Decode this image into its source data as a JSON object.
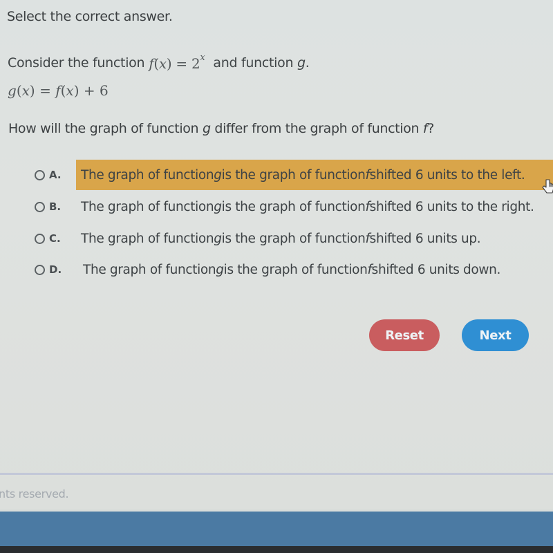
{
  "instruction": "Select the correct answer.",
  "prompt": {
    "lead": "Consider the function",
    "f_def": {
      "name": "f",
      "var": "x",
      "base": "2",
      "exponent": "x"
    },
    "trail": "and function",
    "g_name": "g",
    "trail_end": ".",
    "g_def": {
      "lhs_name": "g",
      "var": "x",
      "rhs_name": "f",
      "op": "+",
      "constant": "6"
    }
  },
  "question": {
    "part1": "How will the graph of function ",
    "g": "g",
    "part2": " differ from the graph of function ",
    "f": "f",
    "part3": "?"
  },
  "options": [
    {
      "letter": "A.",
      "prefix": "The graph of function ",
      "g": "g",
      "middle": " is the graph of function ",
      "f": "f",
      "suffix": " shifted 6 units to the left.",
      "selected": true
    },
    {
      "letter": "B.",
      "prefix": "The graph of function ",
      "g": "g",
      "middle": " is the graph of function ",
      "f": "f",
      "suffix": " shifted 6 units to the right.",
      "selected": false
    },
    {
      "letter": "C.",
      "prefix": "The graph of function ",
      "g": "g",
      "middle": " is the graph of function ",
      "f": "f",
      "suffix": " shifted 6 units up.",
      "selected": false
    },
    {
      "letter": "D.",
      "prefix": "The graph of function ",
      "g": "g",
      "middle": " is the graph of function ",
      "f": "f",
      "suffix": " shifted 6 units down.",
      "selected": false
    }
  ],
  "buttons": {
    "reset": "Reset",
    "next": "Next"
  },
  "footer": {
    "text": "nts reserved."
  },
  "colors": {
    "highlight": "#d9a54a",
    "reset": "#c95d5f",
    "next": "#2f8fd3",
    "bar": "#4b7aa3"
  }
}
